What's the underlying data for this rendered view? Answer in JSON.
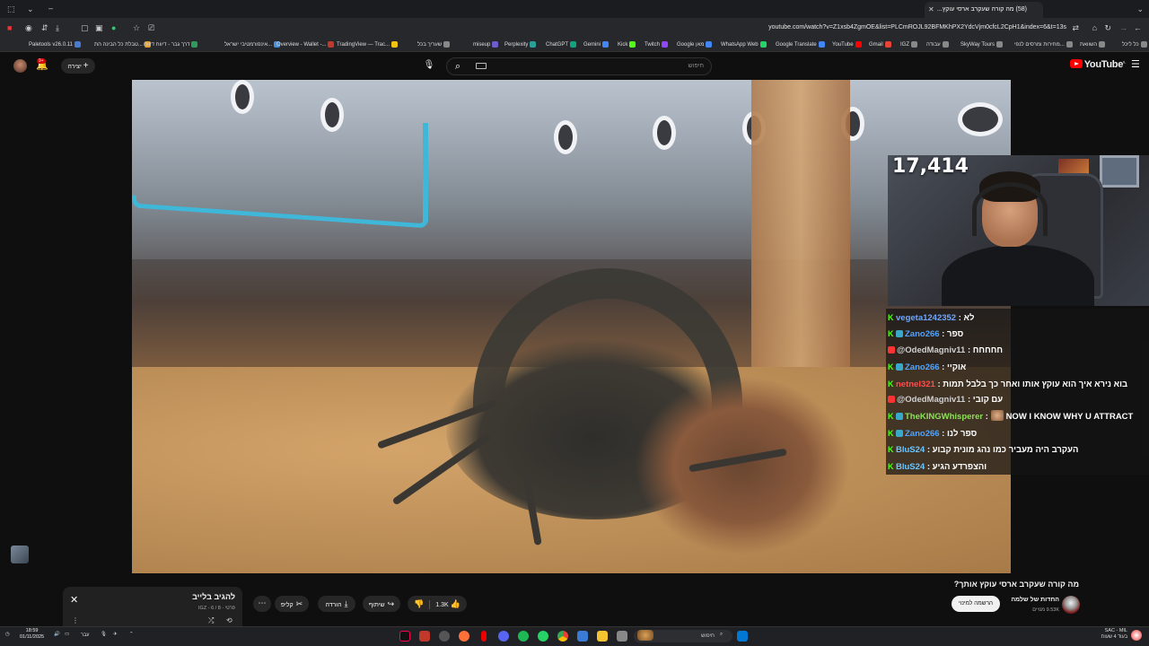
{
  "browser": {
    "tab_title": "(58) מה קורה שעקרב ארסי עוקץ...",
    "url": "youtube.com/watch?v=Z1xsb4ZgmOE&list=PLCmROJL92BFMKhPX2YdcVjm0cfcL2CpH1&index=6&t=13s",
    "bookmarks": [
      {
        "label": "Paletools v26.0.11",
        "color": "#4a7bd1"
      },
      {
        "label": "טבלת כל הבינה הת...",
        "color": "#e0a030"
      },
      {
        "label": "דרך גבר - דיווח דיווח",
        "color": "#2e9b5b"
      },
      {
        "label": "אינפורמטיבי ישראל...",
        "color": "#4a90d9"
      },
      {
        "label": "Overview - Wallet -...",
        "color": "#c0392b"
      },
      {
        "label": "TradingView — Trac...",
        "color": "#f1c40f"
      },
      {
        "label": "שעריך בכל",
        "color": "#888"
      },
      {
        "label": "miseup",
        "color": "#6d5ccf"
      },
      {
        "label": "Perplexity",
        "color": "#2aa198"
      },
      {
        "label": "ChatGPT",
        "color": "#10a37f"
      },
      {
        "label": "Gemini",
        "color": "#4285f4"
      },
      {
        "label": "Kick",
        "color": "#53fc18"
      },
      {
        "label": "Twitch",
        "color": "#9146ff"
      },
      {
        "label": "Google מאן",
        "color": "#4285f4"
      },
      {
        "label": "WhatsApp Web",
        "color": "#25d366"
      },
      {
        "label": "Google Translate",
        "color": "#4285f4"
      },
      {
        "label": "YouTube",
        "color": "#ff0000"
      },
      {
        "label": "Gmail",
        "color": "#ea4335"
      },
      {
        "label": "IGZ",
        "color": "#888"
      },
      {
        "label": "עבודה",
        "color": "#888"
      },
      {
        "label": "SkyWay Tours",
        "color": "#888"
      },
      {
        "label": "מחירות ומרסים לנפי...",
        "color": "#888"
      },
      {
        "label": "השוואת",
        "color": "#888"
      },
      {
        "label": "כל ליכל",
        "color": "#888"
      }
    ]
  },
  "masthead": {
    "logo_text": "YouTube",
    "logo_region": "IL",
    "search_placeholder": "חיפוש",
    "create_label": "יצירה",
    "notification_count": "9+"
  },
  "stream": {
    "viewer_count": "17,414",
    "chat": [
      {
        "user": "vegeta1242352",
        "user_color": "#6ea7ff",
        "message": "לא",
        "badge": "kick",
        "badge_color": "#53fc18"
      },
      {
        "user": "Zano266",
        "user_color": "#4fa3ff",
        "message": "ספר",
        "badge": "kick",
        "badge_color": "#53fc18"
      },
      {
        "user": "@OdedMagniv11",
        "user_color": "#d0d0d0",
        "message": "חחחחח",
        "badge": "yt",
        "badge_color": "#ff3333"
      },
      {
        "user": "Zano266",
        "user_color": "#4fa3ff",
        "message": "אוקיי",
        "badge": "kick",
        "badge_color": "#53fc18"
      },
      {
        "user": "netnel321",
        "user_color": "#ff4d4d",
        "message": "בוא נירא איך הוא עוקץ אותו ואחר כך בלבל תמות",
        "badge": "kick",
        "badge_color": "#53fc18"
      },
      {
        "user": "@OdedMagniv11",
        "user_color": "#d0d0d0",
        "message": "עם קובי",
        "badge": "yt",
        "badge_color": "#ff3333"
      },
      {
        "user": "TheKINGWhisperer",
        "user_color": "#8ee05a",
        "message": "NOW I KNOW WHY U ATTRACT",
        "badge": "kick",
        "badge_color": "#53fc18"
      },
      {
        "user": "Zano266",
        "user_color": "#4fa3ff",
        "message": "ספר לנו",
        "badge": "kick",
        "badge_color": "#53fc18"
      },
      {
        "user": "BluS24",
        "user_color": "#6ec6ff",
        "message": "העקרב היה מעביר כמו נהג מונית קבוע",
        "badge": "kick",
        "badge_color": "#53fc18"
      },
      {
        "user": "BluS24",
        "user_color": "#6ec6ff",
        "message": "והצפרדע הגיע",
        "badge": "kick",
        "badge_color": "#53fc18"
      }
    ]
  },
  "video_info": {
    "title": "מה קורה שעקרב ארסי עוקץ אותך?",
    "channel_name": "החדות של שלמה",
    "subscribers": "9.53K מנויים",
    "subscribe_label": "הרשמה למינוי",
    "like_count": "1.3K",
    "share_label": "שיתוף",
    "download_label": "הורדה",
    "clip_label": "קליפ"
  },
  "playlist": {
    "title": "להגיב בלייב",
    "meta": "פרטי - IGZ - 6 / 8"
  },
  "taskbar": {
    "time": "18:59",
    "date": "01/11/2025",
    "search_placeholder": "חיפוש",
    "weather": "עבר",
    "market": "SAC - MIL",
    "market_sub": "בעוד 4 שעות"
  }
}
